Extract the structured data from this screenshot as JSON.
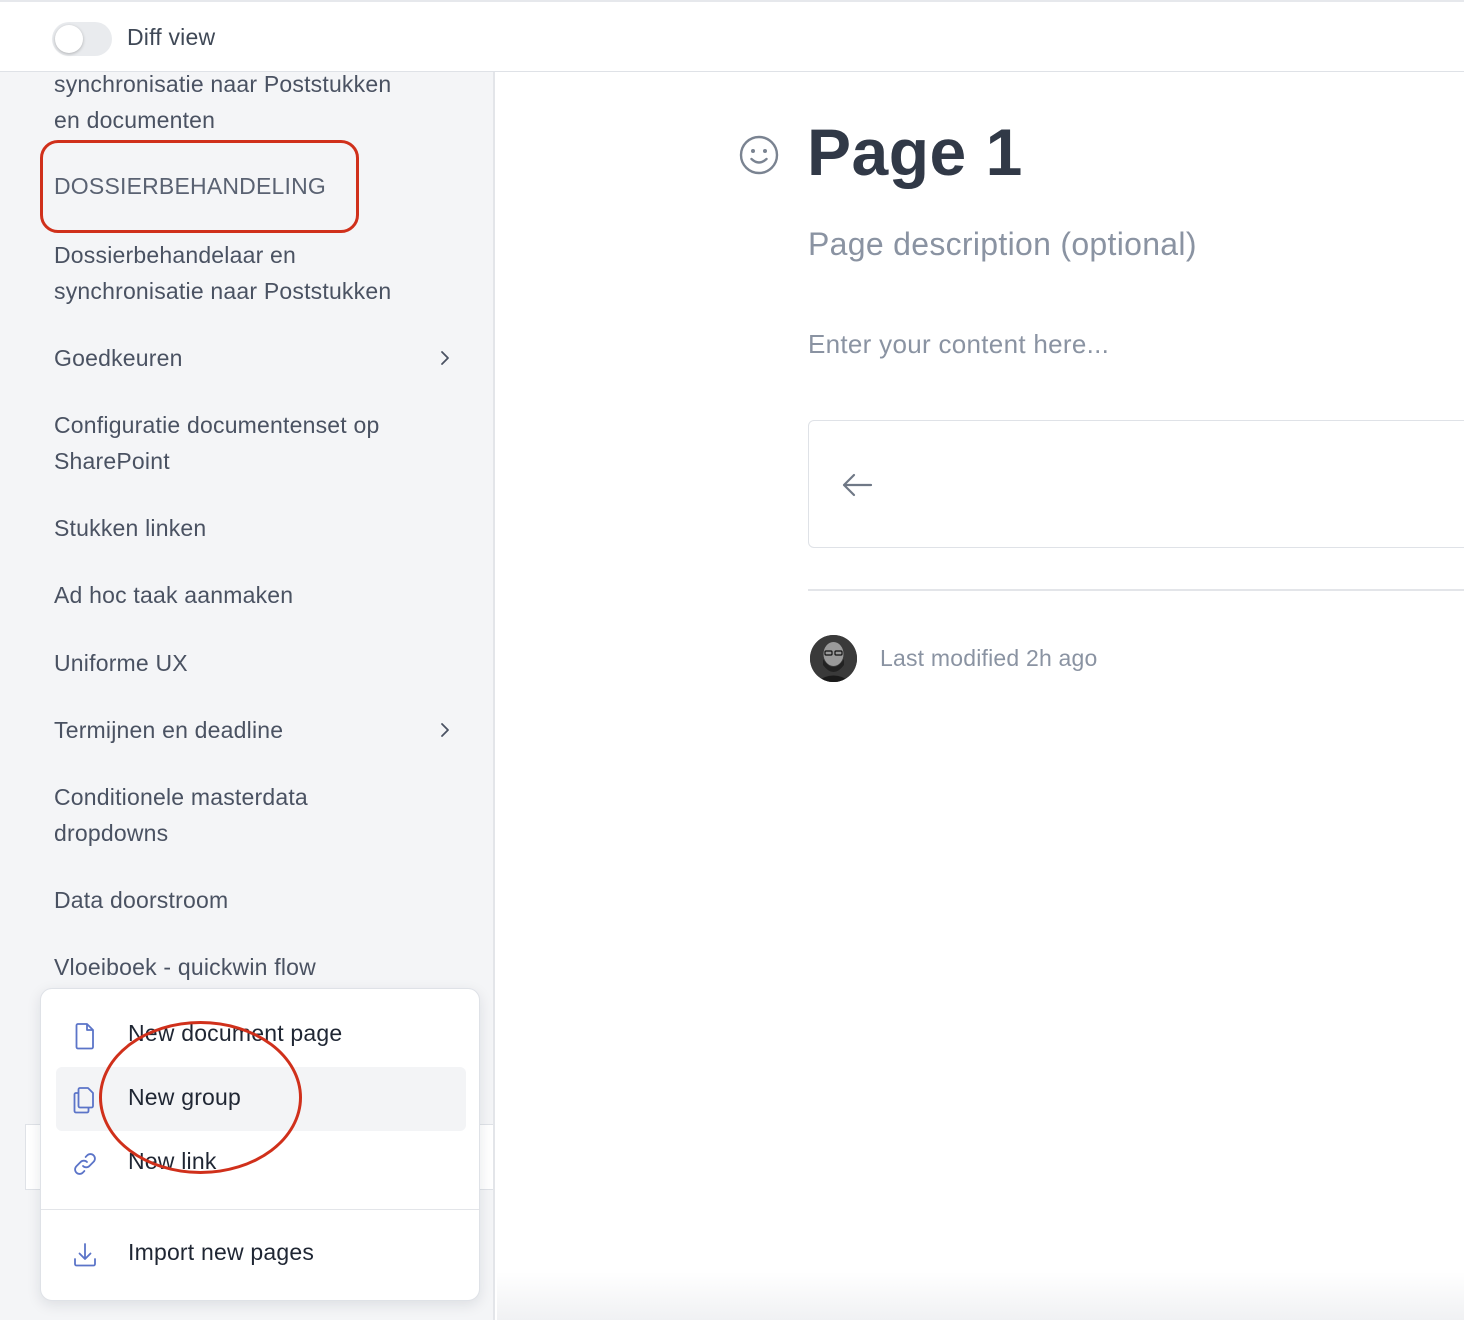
{
  "topbar": {
    "toggle_label": "Diff view",
    "toggle_on": false
  },
  "sidebar": {
    "items": [
      {
        "label": "synchronisatie naar Poststukken en documenten",
        "lines": [
          "synchronisatie naar Poststukken",
          "en documenten"
        ],
        "has_children": false
      },
      {
        "label": "DOSSIERBEHANDELING",
        "type": "group-heading",
        "has_children": false
      },
      {
        "label": "Dossierbehandelaar en synchronisatie naar Poststukken",
        "lines": [
          "Dossierbehandelaar en",
          "synchronisatie naar Poststukken"
        ],
        "has_children": false
      },
      {
        "label": "Goedkeuren",
        "has_children": true
      },
      {
        "label": "Configuratie documentenset op SharePoint",
        "lines": [
          "Configuratie documentenset op",
          "SharePoint"
        ],
        "has_children": false
      },
      {
        "label": "Stukken linken",
        "has_children": false
      },
      {
        "label": "Ad hoc taak aanmaken",
        "has_children": false
      },
      {
        "label": "Uniforme UX",
        "has_children": false
      },
      {
        "label": "Termijnen en deadline",
        "has_children": true
      },
      {
        "label": "Conditionele masterdata dropdowns",
        "lines": [
          "Conditionele masterdata",
          "dropdowns"
        ],
        "has_children": false
      },
      {
        "label": "Data doorstroom",
        "has_children": false
      },
      {
        "label": "Vloeiboek - quickwin flow",
        "has_children": false
      }
    ]
  },
  "menu": {
    "items": [
      {
        "label": "New document page",
        "icon": "document-icon"
      },
      {
        "label": "New group",
        "icon": "copy-group-icon",
        "active": true
      },
      {
        "label": "New link",
        "icon": "link-icon"
      }
    ],
    "import": {
      "label": "Import new pages",
      "icon": "download-icon"
    }
  },
  "main": {
    "title": "Page 1",
    "description_placeholder": "Page description (optional)",
    "content_placeholder": "Enter your content here...",
    "last_modified": "Last modified 2h ago"
  },
  "colors": {
    "annotation": "#d0301b",
    "sidebar_bg": "#f4f5f7",
    "icon_blue": "#5b74c8",
    "muted_text": "#8a93a2"
  }
}
